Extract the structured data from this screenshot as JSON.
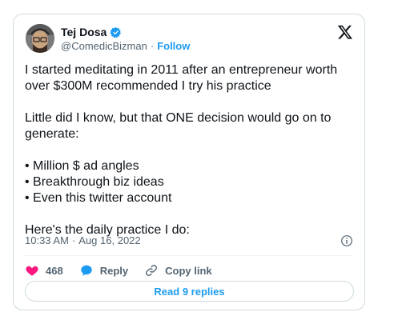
{
  "author": {
    "name": "Tej Dosa",
    "handle": "@ComedicBizman",
    "separator": "·",
    "follow_label": "Follow"
  },
  "tweet": {
    "paragraphs": [
      "I started meditating in 2011 after an entrepreneur worth over $300M recommended I try his practice",
      "Little did I know, but that ONE decision would go on to generate:",
      "• Million $ ad angles",
      "• Breakthrough biz ideas",
      "• Even this twitter account",
      "Here's the daily practice I do:"
    ],
    "time": "10:33 AM",
    "meta_separator": "·",
    "date": "Aug 16, 2022"
  },
  "actions": {
    "likes": "468",
    "reply_label": "Reply",
    "copy_link_label": "Copy link"
  },
  "read_replies_label": "Read 9 replies",
  "colors": {
    "accent": "#1d9bf0",
    "like": "#f91880",
    "text": "#0f1419",
    "muted": "#536471"
  },
  "icons": [
    "verified-badge-icon",
    "x-logo-icon",
    "info-icon",
    "heart-icon",
    "reply-bubble-icon",
    "link-icon"
  ]
}
